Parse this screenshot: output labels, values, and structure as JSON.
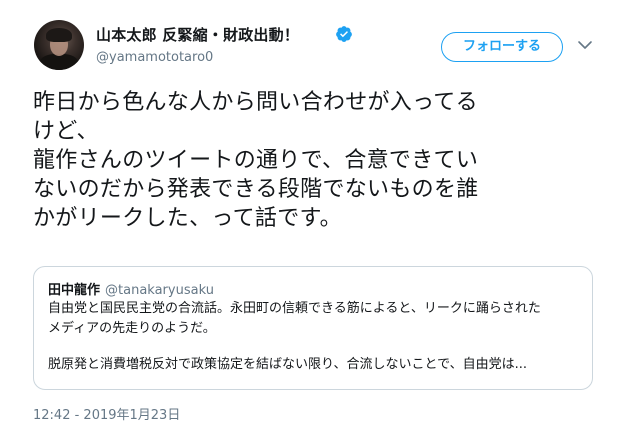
{
  "author": {
    "display_name": "山本太郎 反緊縮・財政出動！",
    "handle": "@yamamototaro0",
    "verified": true
  },
  "actions": {
    "follow_label": "フォローする"
  },
  "tweet": {
    "lines": [
      "昨日から色んな人から問い合わせが入ってる",
      "けど、",
      "龍作さんのツイートの通りで、合意できてい",
      "ないのだから発表できる段階でないものを誰",
      "かがリークした、って話です。"
    ]
  },
  "quoted_tweet": {
    "name": "田中龍作",
    "handle": "@tanakaryusaku",
    "lines": [
      "自由党と国民民主党の合流話。永田町の信頼できる筋によると、リークに踊らされた",
      "メディアの先走りのようだ。",
      "脱原発と消費増税反対で政策協定を結ばない限り、合流しないことで、自由党は..."
    ]
  },
  "timestamp": "12:42 - 2019年1月23日",
  "colors": {
    "accent": "#1da1f2",
    "muted": "#657786",
    "border": "#ccd6dd",
    "text": "#14171a"
  }
}
